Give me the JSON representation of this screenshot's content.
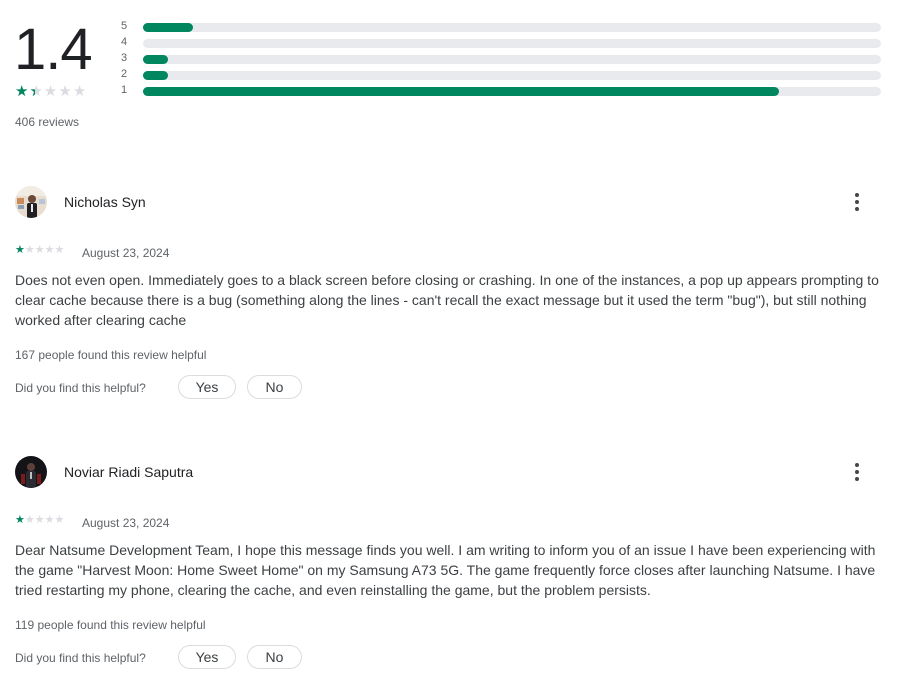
{
  "rating_summary": {
    "score": "1.4",
    "stars_value": 1.4,
    "review_count": "406 reviews",
    "histogram": [
      {
        "label": "5",
        "fraction": 0.068
      },
      {
        "label": "4",
        "fraction": 0.0
      },
      {
        "label": "3",
        "fraction": 0.034
      },
      {
        "label": "2",
        "fraction": 0.034
      },
      {
        "label": "1",
        "fraction": 0.862
      }
    ]
  },
  "reviews": [
    {
      "author": "Nicholas Syn",
      "avatar_icon": "user-photo-icon",
      "stars": 1,
      "date": "August 23, 2024",
      "text": "Does not even open. Immediately goes to a black screen before closing or crashing. In one of the instances, a pop up appears prompting to clear cache because there is a bug (something along the lines - can't recall the exact message but it used the term \"bug\"), but still nothing worked after clearing cache",
      "helpful_count": "167 people found this review helpful",
      "helpful_question": "Did you find this helpful?",
      "yes_label": "Yes",
      "no_label": "No"
    },
    {
      "author": "Noviar Riadi Saputra",
      "avatar_icon": "user-photo-icon",
      "stars": 1,
      "date": "August 23, 2024",
      "text": "Dear Natsume Development Team, I hope this message finds you well. I am writing to inform you of an issue I have been experiencing with the game \"Harvest Moon: Home Sweet Home\" on my Samsung A73 5G. The game frequently force closes after launching Natsume. I have tried restarting my phone, clearing the cache, and even reinstalling the game, but the problem persists.",
      "helpful_count": "119 people found this review helpful",
      "helpful_question": "Did you find this helpful?",
      "yes_label": "Yes",
      "no_label": "No"
    }
  ],
  "colors": {
    "accent_green": "#01875f",
    "track_gray": "#e8eaed",
    "text_secondary": "#5f6368"
  }
}
